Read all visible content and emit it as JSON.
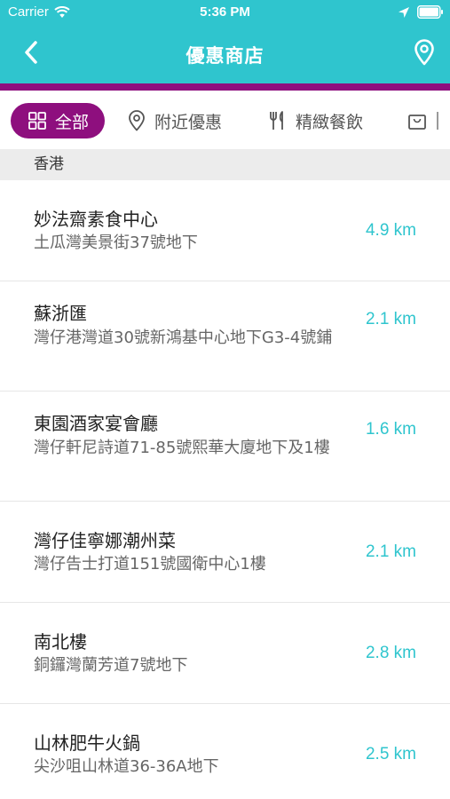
{
  "status_bar": {
    "carrier": "Carrier",
    "time": "5:36 PM",
    "icons": [
      "wifi-icon",
      "location-arrow-icon",
      "battery-icon"
    ]
  },
  "nav": {
    "title": "優惠商店",
    "back_icon": "chevron-left-icon",
    "map_icon": "map-pin-icon"
  },
  "colors": {
    "header": "#2fc5ce",
    "accent": "#8e0f7e",
    "distance": "#2fc5ce"
  },
  "tabs": [
    {
      "label": "全部",
      "icon": "grid-icon",
      "selected": true
    },
    {
      "label": "附近優惠",
      "icon": "map-pin-icon",
      "selected": false
    },
    {
      "label": "精緻餐飲",
      "icon": "fork-knife-icon",
      "selected": false
    },
    {
      "label": "",
      "icon": "shopping-bag-icon",
      "selected": false
    }
  ],
  "section": {
    "title": "香港"
  },
  "stores": [
    {
      "name": "妙法齋素食中心",
      "address": "土瓜灣美景街37號地下",
      "distance": "4.9 km"
    },
    {
      "name": "蘇浙匯",
      "address": "灣仔港灣道30號新鴻基中心地下G3-4號鋪",
      "distance": "2.1 km"
    },
    {
      "name": "東園酒家宴會廳",
      "address": "灣仔軒尼詩道71-85號熙華大廈地下及1樓",
      "distance": "1.6 km"
    },
    {
      "name": "灣仔佳寧娜潮州菜",
      "address": "灣仔告士打道151號國衛中心1樓",
      "distance": "2.1 km"
    },
    {
      "name": "南北樓",
      "address": "銅鑼灣蘭芳道7號地下",
      "distance": "2.8 km"
    },
    {
      "name": "山林肥牛火鍋",
      "address": "尖沙咀山林道36-36A地下",
      "distance": "2.5 km"
    }
  ]
}
